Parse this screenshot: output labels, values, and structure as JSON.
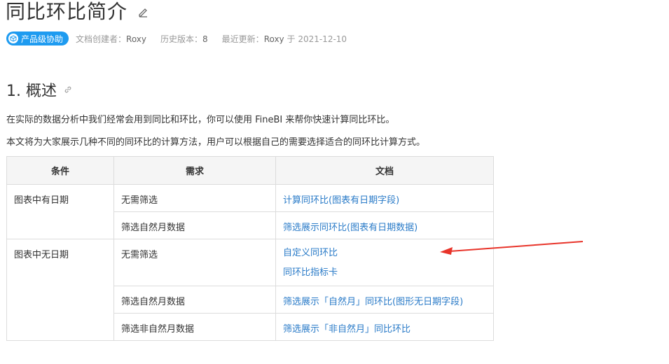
{
  "page": {
    "title": "同比环比简介",
    "badge": "产品级协助",
    "meta": {
      "creator_label": "文档创建者：",
      "creator_value": "Roxy",
      "version_label": "历史版本：",
      "version_value": "8",
      "updated_label": "最近更新：",
      "updated_value": "Roxy",
      "updated_at": "于 2021-12-10"
    }
  },
  "section": {
    "heading": "1. 概述",
    "para1": "在实际的数据分析中我们经常会用到同比和环比，你可以使用 FineBI 来帮你快速计算同比环比。",
    "para2": "本文将为大家展示几种不同的同环比的计算方法，用户可以根据自己的需要选择适合的同环比计算方式。"
  },
  "table": {
    "headers": [
      "条件",
      "需求",
      "文档"
    ],
    "groups": [
      {
        "condition": "图表中有日期",
        "rows": [
          {
            "need": "无需筛选",
            "docs": [
              "计算同环比(图表有日期字段)"
            ]
          },
          {
            "need": "筛选自然月数据",
            "docs": [
              "筛选展示同环比(图表有日期数据)"
            ]
          }
        ]
      },
      {
        "condition": "图表中无日期",
        "rows": [
          {
            "need": "无需筛选",
            "docs": [
              "自定义同环比",
              "同环比指标卡"
            ]
          },
          {
            "need": "筛选自然月数据",
            "docs": [
              "筛选展示「自然月」同环比(图形无日期字段)"
            ]
          },
          {
            "need": "筛选非自然月数据",
            "docs": [
              "筛选展示「非自然月」同比环比"
            ]
          }
        ]
      }
    ]
  },
  "colors": {
    "link": "#2a7bc8",
    "badge": "#1e9bf0",
    "annotation_arrow": "#e8342a"
  }
}
